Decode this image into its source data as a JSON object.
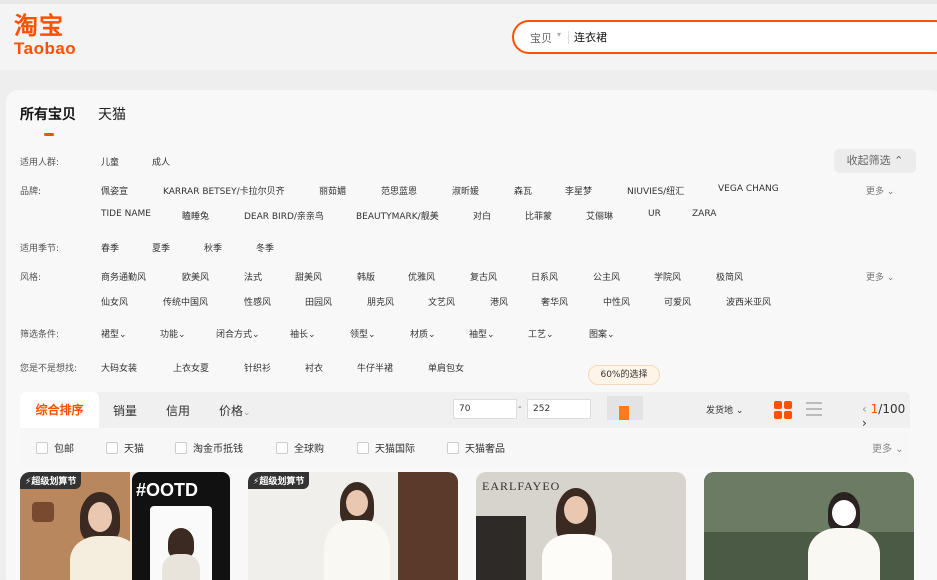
{
  "header": {
    "logo_cn": "淘宝",
    "logo_en": "Taobao",
    "search": {
      "category": "宝贝",
      "query": "连衣裙"
    }
  },
  "tabs": [
    {
      "label": "所有宝贝",
      "active": true
    },
    {
      "label": "天猫",
      "active": false
    }
  ],
  "filters": {
    "collapse_label": "收起筛选",
    "more_label": "更多",
    "audience": {
      "label": "适用人群:",
      "items": [
        "儿童",
        "成人"
      ]
    },
    "brand": {
      "label": "品牌:",
      "items": [
        "佩姿宣",
        "KARRAR BETSEY/卡拉尔贝齐",
        "丽茹媚",
        "范思蓝恩",
        "淑昕媛",
        "森瓦",
        "李星梦",
        "NIUVIES/纽汇",
        "VEGA CHANG",
        "TIDE NAME",
        "瞌睡兔",
        "DEAR BIRD/亲亲鸟",
        "BEAUTYMARK/靓美",
        "对白",
        "比菲蒙",
        "艾俪琳",
        "UR",
        "ZARA"
      ]
    },
    "season": {
      "label": "适用季节:",
      "items": [
        "春季",
        "夏季",
        "秋季",
        "冬季"
      ]
    },
    "style": {
      "label": "风格:",
      "items": [
        "商务通勤风",
        "欧美风",
        "法式",
        "甜美风",
        "韩版",
        "优雅风",
        "复古风",
        "日系风",
        "公主风",
        "学院风",
        "极简风",
        "仙女风",
        "传统中国风",
        "性感风",
        "田园风",
        "朋克风",
        "文艺风",
        "港风",
        "奢华风",
        "中性风",
        "可爱风",
        "波西米亚风"
      ]
    },
    "conditions": {
      "label": "筛选条件:",
      "items": [
        "裙型",
        "功能",
        "闭合方式",
        "袖长",
        "领型",
        "材质",
        "袖型",
        "工艺",
        "图案"
      ]
    },
    "want": {
      "label": "您是不是想找:",
      "items": [
        "大码女装",
        "上衣女夏",
        "针织衫",
        "衬衣",
        "牛仔半裙",
        "单肩包女"
      ]
    }
  },
  "sort_bar": {
    "items": [
      "综合排序",
      "销量",
      "信用",
      "价格"
    ],
    "price_min": "70",
    "price_max": "252",
    "price_dash": "-",
    "tooltip": "60%的选择",
    "ship_from": "发货地",
    "page_current": "1",
    "page_total": "/100"
  },
  "checks": [
    "包邮",
    "天猫",
    "淘金币抵钱",
    "全球购",
    "天猫国际",
    "天猫奢品"
  ],
  "checks_more": "更多",
  "products": [
    {
      "promo": "超级划算节",
      "overlay": ""
    },
    {
      "promo": "",
      "overlay": "#OOTD"
    },
    {
      "promo": "超级划算节",
      "overlay": ""
    },
    {
      "promo": "",
      "overlay": "EARLFAYEO"
    },
    {
      "promo": "",
      "overlay": ""
    }
  ],
  "colors": {
    "accent": "#ff5000"
  }
}
